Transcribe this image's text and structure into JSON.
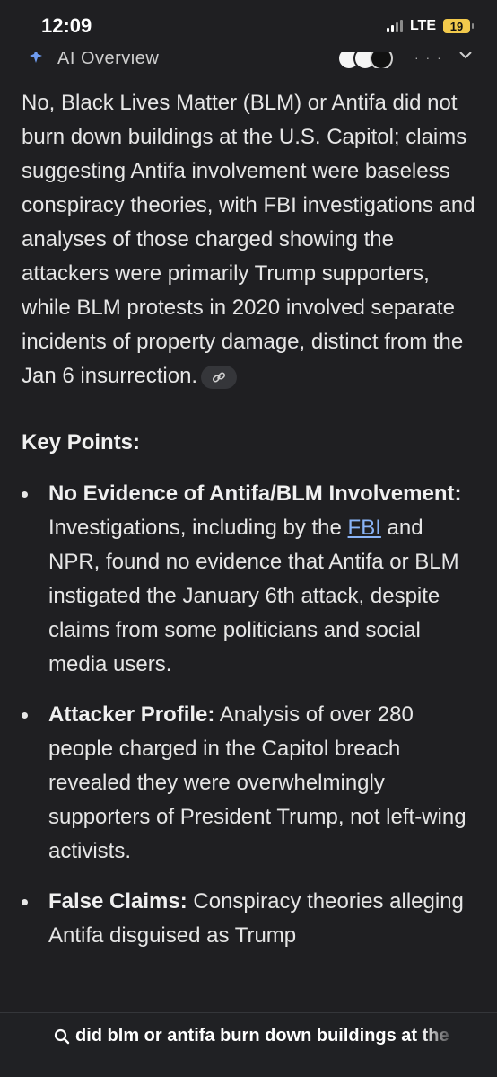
{
  "status_bar": {
    "time": "12:09",
    "network": "LTE",
    "battery": "19"
  },
  "overview": {
    "label": "AI Overview",
    "more": "· · ·"
  },
  "summary": "No, Black Lives Matter (BLM) or Antifa did not burn down buildings at the U.S. Capitol; claims suggesting Antifa involvement were baseless conspiracy theories, with FBI investigations and analyses of those charged showing the attackers were primarily Trump supporters, while BLM protests in 2020 involved separate incidents of property damage, distinct from the Jan 6 insurrection.",
  "key_points": {
    "heading": "Key Points:",
    "items": [
      {
        "title": "No Evidence of Antifa/BLM Involvement:",
        "text_before": " Investigations, including by the ",
        "link": "FBI",
        "text_after": " and NPR, found no evidence that Antifa or BLM instigated the January 6th attack, despite claims from some politicians and social media users."
      },
      {
        "title": "Attacker Profile:",
        "text": " Analysis of over 280 people charged in the Capitol breach revealed they were overwhelmingly supporters of President Trump, not left-wing activists."
      },
      {
        "title": "False Claims:",
        "text": " Conspiracy theories alleging Antifa disguised as Trump"
      }
    ]
  },
  "bottom_bar": {
    "query": "did blm or antifa burn down buildings at the"
  },
  "colors": {
    "background": "#1f1f22",
    "text": "#e6e6e6",
    "link": "#8ab4f8",
    "battery": "#f2c94c"
  }
}
